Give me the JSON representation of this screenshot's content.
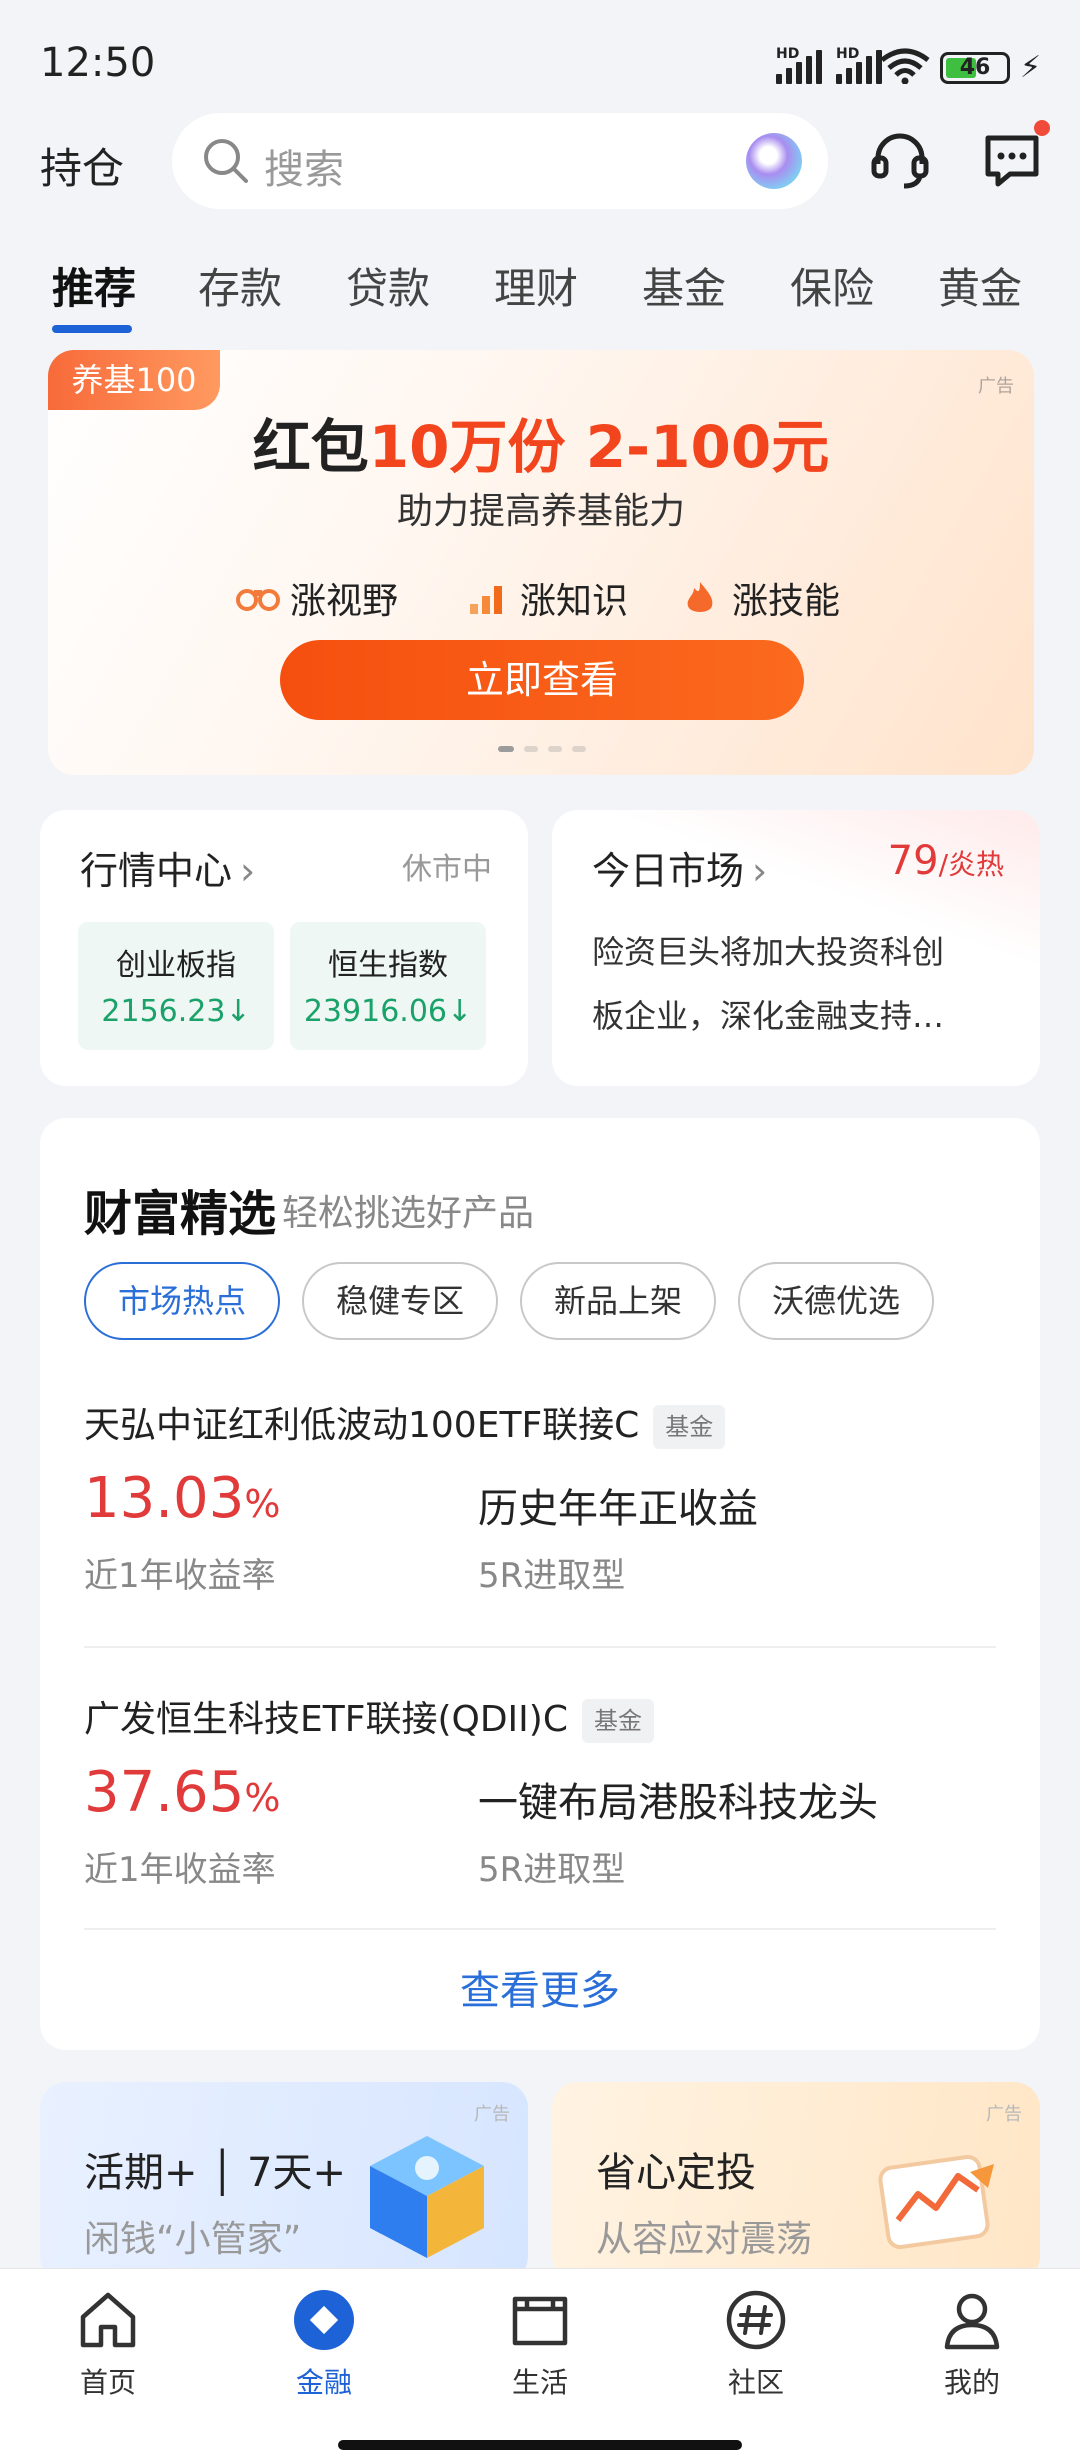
{
  "status_bar": {
    "time": "12:50",
    "hd1": "HD",
    "hd2": "HD",
    "battery": "46"
  },
  "header": {
    "title": "持仓",
    "search_placeholder": "搜索"
  },
  "tabs": [
    "推荐",
    "存款",
    "贷款",
    "理财",
    "基金",
    "保险",
    "黄金"
  ],
  "banner": {
    "tag": "养基100",
    "ad_label": "广告",
    "title_plain": "红包",
    "title_highlight": "10万份 2-100元",
    "subtitle": "助力提高养基能力",
    "features": [
      "涨视野",
      "涨知识",
      "涨技能"
    ],
    "button": "立即查看"
  },
  "market_center": {
    "title": "行情中心",
    "status": "休市中",
    "indices": [
      {
        "name": "创业板指",
        "value": "2156.23"
      },
      {
        "name": "恒生指数",
        "value": "23916.06"
      }
    ]
  },
  "today_market": {
    "title": "今日市场",
    "heat_value": "79",
    "heat_label": "/炎热",
    "news_line1": "险资巨头将加大投资科创",
    "news_line2": "板企业，深化金融支持…"
  },
  "wealth": {
    "title": "财富精选",
    "subtitle": "轻松挑选好产品",
    "chips": [
      "市场热点",
      "稳健专区",
      "新品上架",
      "沃德优选"
    ],
    "products": [
      {
        "name": "天弘中证红利低波动100ETF联接C",
        "badge": "基金",
        "rate": "13.03",
        "pct": "%",
        "rate_label": "近1年收益率",
        "desc": "历史年年正收益",
        "risk": "5R进取型"
      },
      {
        "name": "广发恒生科技ETF联接(QDII)C",
        "badge": "基金",
        "rate": "37.65",
        "pct": "%",
        "rate_label": "近1年收益率",
        "desc": "一键布局港股科技龙头",
        "risk": "5R进取型"
      }
    ],
    "more": "查看更多"
  },
  "promos": [
    {
      "ad": "广告",
      "title": "活期+ │ 7天+",
      "subtitle": "闲钱“小管家”"
    },
    {
      "ad": "广告",
      "title": "省心定投",
      "subtitle": "从容应对震荡"
    }
  ],
  "nav": [
    {
      "label": "首页",
      "icon": "home-icon"
    },
    {
      "label": "金融",
      "icon": "finance-icon"
    },
    {
      "label": "生活",
      "icon": "life-icon"
    },
    {
      "label": "社区",
      "icon": "community-icon"
    },
    {
      "label": "我的",
      "icon": "profile-icon"
    }
  ],
  "colors": {
    "accent": "#1d62d6",
    "up_red": "#e03a3a",
    "down_green": "#1aa26a",
    "banner_orange": "#f54f0f"
  }
}
